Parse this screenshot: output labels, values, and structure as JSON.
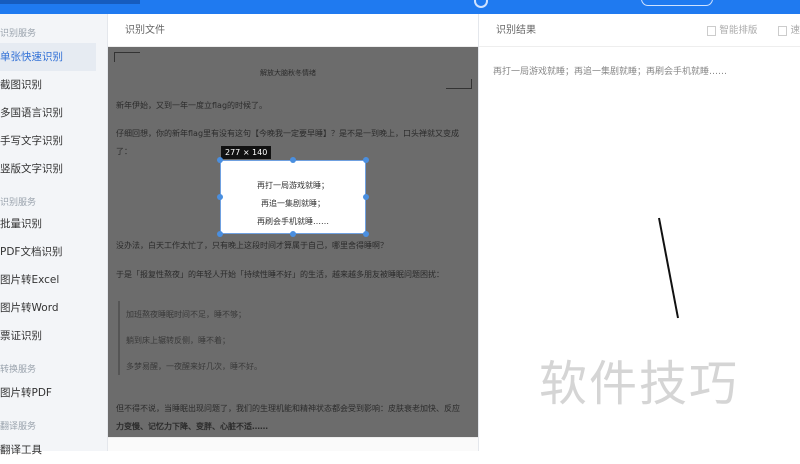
{
  "sidebar": {
    "sections": [
      "识别服务",
      "识别服务",
      "转换服务",
      "翻译服务"
    ],
    "items": [
      "单张快速识别",
      "截图识别",
      "多国语言识别",
      "手写文字识别",
      "竖版文字识别",
      "批量识别",
      "PDF文档识别",
      "图片转Excel",
      "图片转Word",
      "票证识别",
      "图片转PDF",
      "翻译工具"
    ]
  },
  "middle": {
    "header": "识别文件",
    "doc": {
      "title": "解放大脑秋冬情绪",
      "lines": [
        "新年伊始，又到一年一度立flag的时候了。",
        "仔细回想，你的新年flag里有没有这句【今晚我一定要早睡】？是不是一到晚上，口头禅就又变成",
        "了：",
        "没办法，白天工作太忙了，只有晚上这段时间才算属于自己，哪里舍得睡啊？",
        "于是「报复性熬夜」的年轻人开始「持续性睡不好」的生活，越来越多朋友被睡眠问题困扰：",
        "加班熬夜睡眠时间不足，睡不够；",
        "躺到床上辗转反侧，睡不着；",
        "多梦易醒，一夜醒来好几次，睡不好。",
        "但不得不说，当睡眠出现问题了，我们的生理机能和精神状态都会受到影响：皮肤衰老加快、反应",
        "力变慢、记忆力下降、变胖、心脏不适……"
      ]
    },
    "selection": {
      "size": "277 × 140",
      "lines": [
        "再打一局游戏就睡；",
        "再追一集剧就睡；",
        "再刷会手机就睡……"
      ]
    }
  },
  "right": {
    "header": "识别结果",
    "tools": [
      "智能排版",
      "速"
    ],
    "result": "再打一局游戏就睡；再追一集剧就睡；再刷会手机就睡……",
    "watermark": "软件技巧"
  },
  "colors": {
    "brand": "#1f7af0",
    "overlay": "#6c6c6c"
  }
}
